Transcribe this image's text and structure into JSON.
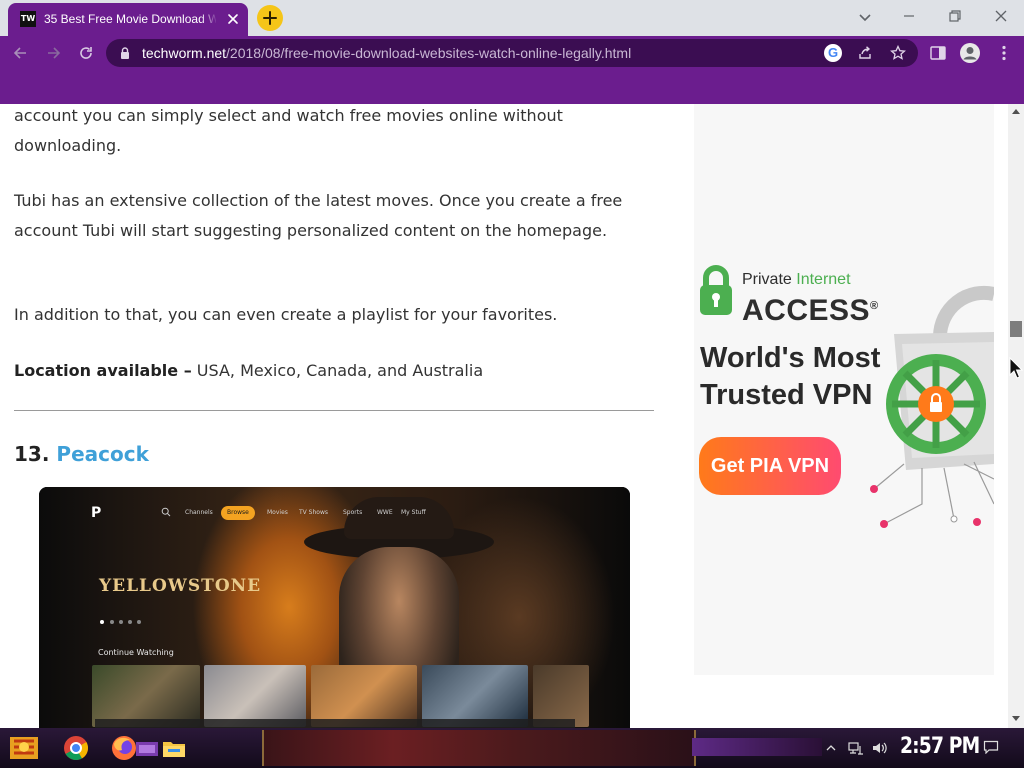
{
  "browser": {
    "tab": {
      "favicon_text": "TW",
      "title": "35 Best Free Movie Download W"
    },
    "address_bar": {
      "host": "techworm.net",
      "path": "/2018/08/free-movie-download-websites-watch-online-legally.html"
    },
    "google_badge": "G"
  },
  "article": {
    "paragraphs": [
      "account you can simply select and watch free movies online without downloading.",
      "Tubi has an extensive collection of the latest moves. Once you create a free account Tubi will start suggesting personalized content on the homepage.",
      "In addition to that, you can even create a playlist for your favorites."
    ],
    "location": {
      "label": "Location available –",
      "value": " USA, Mexico, Canada, and Australia"
    },
    "section": {
      "number": "13. ",
      "title": "Peacock"
    }
  },
  "peacock_screenshot": {
    "logo": "P",
    "nav_tabs": [
      "Channels",
      "Browse",
      "Movies",
      "TV Shows",
      "Sports",
      "WWE",
      "My Stuff"
    ],
    "active_tab": "Browse",
    "show_title": "YELLOWSTONE",
    "row_label": "Continue Watching"
  },
  "ad": {
    "brand_line1_a": "Private ",
    "brand_line1_b": "Internet",
    "brand_line2": "ACCESS",
    "registered": "®",
    "headline_line1": "World's Most",
    "headline_line2": "Trusted VPN",
    "cta": "Get PIA VPN",
    "colors": {
      "cta_start": "#ff7a1a",
      "cta_end": "#ff4b70",
      "brand_green": "#4caf50"
    }
  },
  "taskbar": {
    "clock": "2:57 PM"
  },
  "theme": {
    "browser_frame": "#6b1d8e",
    "omnibox": "#3b0d52",
    "link": "#3fa0d8"
  }
}
